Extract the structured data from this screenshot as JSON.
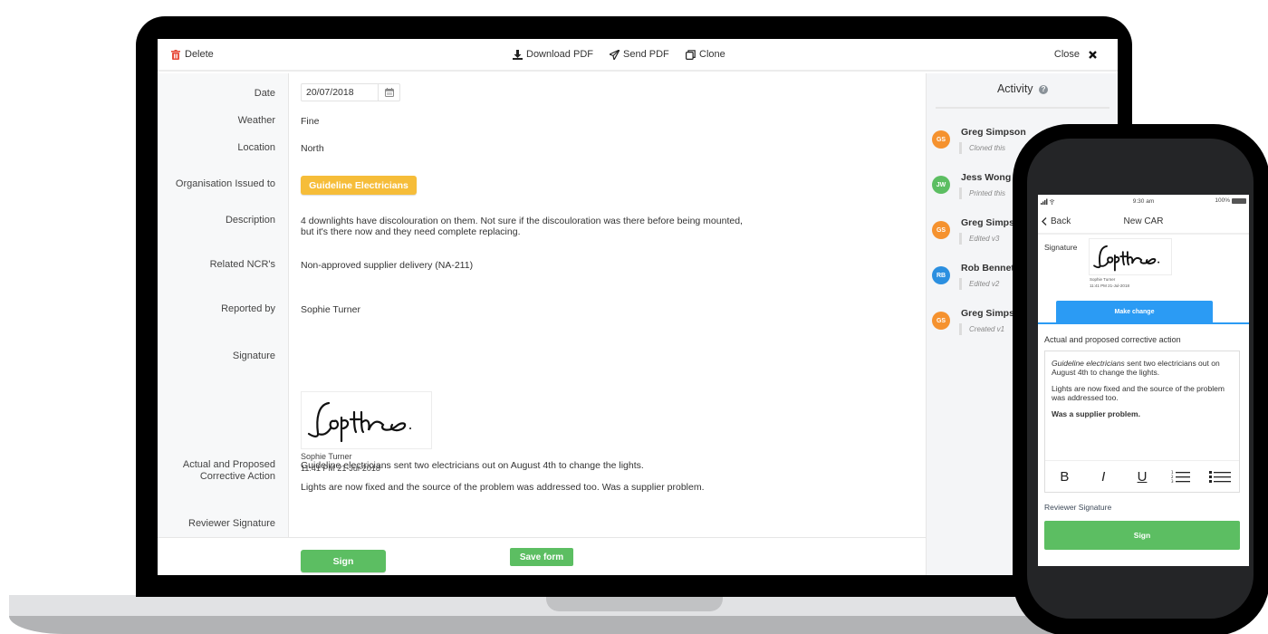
{
  "toolbar": {
    "delete_label": "Delete",
    "download_label": "Download PDF",
    "send_label": "Send PDF",
    "clone_label": "Clone",
    "close_label": "Close"
  },
  "form": {
    "fields": {
      "date": {
        "label": "Date",
        "value": "20/07/2018"
      },
      "weather": {
        "label": "Weather",
        "value": "Fine"
      },
      "location": {
        "label": "Location",
        "value": "North"
      },
      "organisation": {
        "label": "Organisation Issued to",
        "value": "Guideline Electricians"
      },
      "description": {
        "label": "Description",
        "line1": "4 downlights have discolouration on them. Not sure if the discouloration was there before being mounted,",
        "line2": "but it's there now and they need complete replacing."
      },
      "related_ncrs": {
        "label": "Related NCR's",
        "value": "Non-approved supplier delivery (NA-211)"
      },
      "reported_by": {
        "label": "Reported by",
        "value": "Sophie Turner"
      },
      "signature": {
        "label": "Signature",
        "signer": "Sophie Turner",
        "timestamp": "11:41 PM 21-Jul-2018"
      },
      "corrective_action": {
        "label_line1": "Actual and Proposed",
        "label_line2": "Corrective Action",
        "para1": "Guideline electricians sent two electricians out on August 4th to change the lights.",
        "para2": "Lights are now fixed and the source of the problem was addressed too. Was a supplier problem."
      },
      "reviewer_signature": {
        "label": "Reviewer Signature",
        "button": "Sign"
      }
    },
    "save_label": "Save form"
  },
  "activity": {
    "title": "Activity",
    "entries": [
      {
        "initials": "GS",
        "name": "Greg Simpson",
        "note": "Cloned this",
        "color": "#f5922f"
      },
      {
        "initials": "JW",
        "name": "Jess Wong",
        "note": "Printed this",
        "color": "#5cbe62"
      },
      {
        "initials": "GS",
        "name": "Greg Simpson",
        "note": "Edited v3",
        "color": "#f5922f"
      },
      {
        "initials": "RB",
        "name": "Rob Bennett",
        "note": "Edited v2",
        "color": "#2b8fe0"
      },
      {
        "initials": "GS",
        "name": "Greg Simpson",
        "note": "Created v1",
        "color": "#f5922f"
      }
    ]
  },
  "phone": {
    "status": {
      "time": "9:30 am",
      "battery": "100%"
    },
    "nav": {
      "back": "Back",
      "title": "New CAR"
    },
    "signature_label": "Signature",
    "signer": "Sophie Turner",
    "timestamp": "11:41 PM 21-Jul-2018",
    "make_change": "Make change",
    "action_label": "Actual and proposed corrective action",
    "editor": {
      "italic_part": "Guideline electricians",
      "para1_rest": " sent two electricians out on August 4th to change the lights.",
      "para2": "Lights are now fixed and the source of the problem was addressed too.",
      "para3": "Was a supplier problem."
    },
    "format_tools": {
      "bold": "B",
      "italic": "I",
      "underline": "U"
    },
    "reviewer_label": "Reviewer Signature",
    "sign_label": "Sign"
  },
  "colors": {
    "accent_green": "#5cbe62",
    "accent_blue": "#2b9bf4",
    "tag_yellow": "#f6bd39",
    "delete_red": "#e74c3c"
  }
}
